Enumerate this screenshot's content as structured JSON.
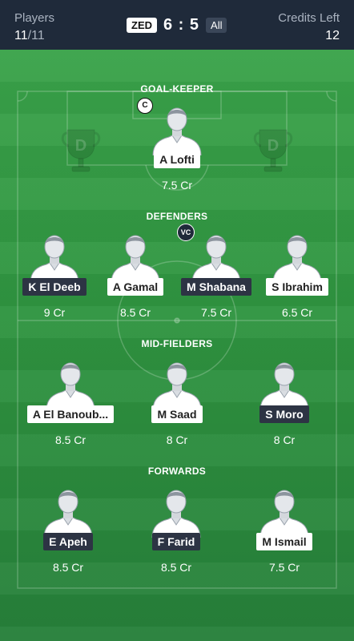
{
  "header": {
    "players_label": "Players",
    "players_selected": "11",
    "players_total": "/11",
    "team": "ZED",
    "score": "6 : 5",
    "filter": "All",
    "credits_label": "Credits Left",
    "credits_value": "12"
  },
  "sections": {
    "gk": "GOAL-KEEPER",
    "def": "DEFENDERS",
    "mid": "MID-FIELDERS",
    "fwd": "FORWARDS"
  },
  "roles": {
    "captain": "C",
    "vice_captain": "VC"
  },
  "players": {
    "gk1": {
      "name": "A Lofti",
      "credits": "7.5 Cr",
      "style": "light"
    },
    "def1": {
      "name": "K El Deeb",
      "credits": "9 Cr",
      "style": "dark"
    },
    "def2": {
      "name": "A Gamal",
      "credits": "8.5 Cr",
      "style": "light"
    },
    "def3": {
      "name": "M Shabana",
      "credits": "7.5 Cr",
      "style": "dark"
    },
    "def4": {
      "name": "S Ibrahim",
      "credits": "6.5 Cr",
      "style": "light"
    },
    "mid1": {
      "name": "A El Banoub...",
      "credits": "8.5 Cr",
      "style": "light"
    },
    "mid2": {
      "name": "M Saad",
      "credits": "8 Cr",
      "style": "light"
    },
    "mid3": {
      "name": "S Moro",
      "credits": "8 Cr",
      "style": "dark"
    },
    "fwd1": {
      "name": "E Apeh",
      "credits": "8.5 Cr",
      "style": "dark"
    },
    "fwd2": {
      "name": "F Farid",
      "credits": "8.5 Cr",
      "style": "dark"
    },
    "fwd3": {
      "name": "M Ismail",
      "credits": "7.5 Cr",
      "style": "light"
    }
  },
  "colors": {
    "header_bg": "#1f2a3a",
    "pitch_green": "#2f9440",
    "dark_tag": "#2d3444"
  },
  "icons": {
    "avatar": "player-silhouette-icon",
    "trophy": "trophy-icon"
  }
}
